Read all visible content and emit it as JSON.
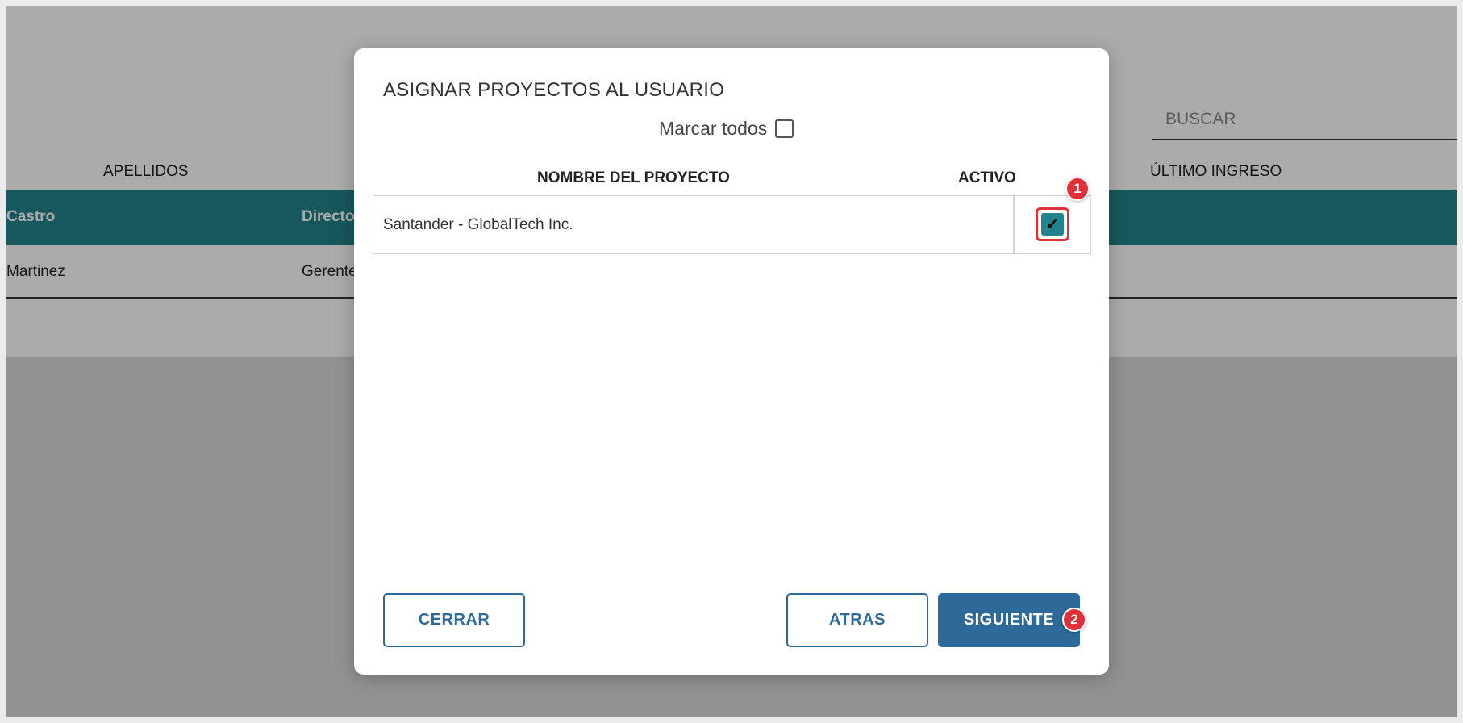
{
  "background": {
    "search_placeholder": "BUSCAR",
    "headers": {
      "apellidos": "APELLIDOS",
      "ultimo_ingreso": "ÚLTIMO INGRESO"
    },
    "rows": [
      {
        "apellidos": "Castro",
        "cargo": "Directo"
      },
      {
        "apellidos": "Martinez",
        "cargo": "Gerente"
      }
    ],
    "accent_color": "#21838b"
  },
  "modal": {
    "title": "ASIGNAR PROYECTOS AL USUARIO",
    "mark_all_label": "Marcar todos",
    "mark_all_checked": false,
    "columns": {
      "name": "NOMBRE DEL PROYECTO",
      "active": "ACTIVO"
    },
    "projects": [
      {
        "name": "Santander - GlobalTech Inc.",
        "active": true
      }
    ],
    "buttons": {
      "close": "CERRAR",
      "back": "ATRAS",
      "next": "SIGUIENTE"
    },
    "primary_color": "#2d6a99"
  },
  "annotations": {
    "step1": "1",
    "step2": "2",
    "color": "#e0303a"
  }
}
